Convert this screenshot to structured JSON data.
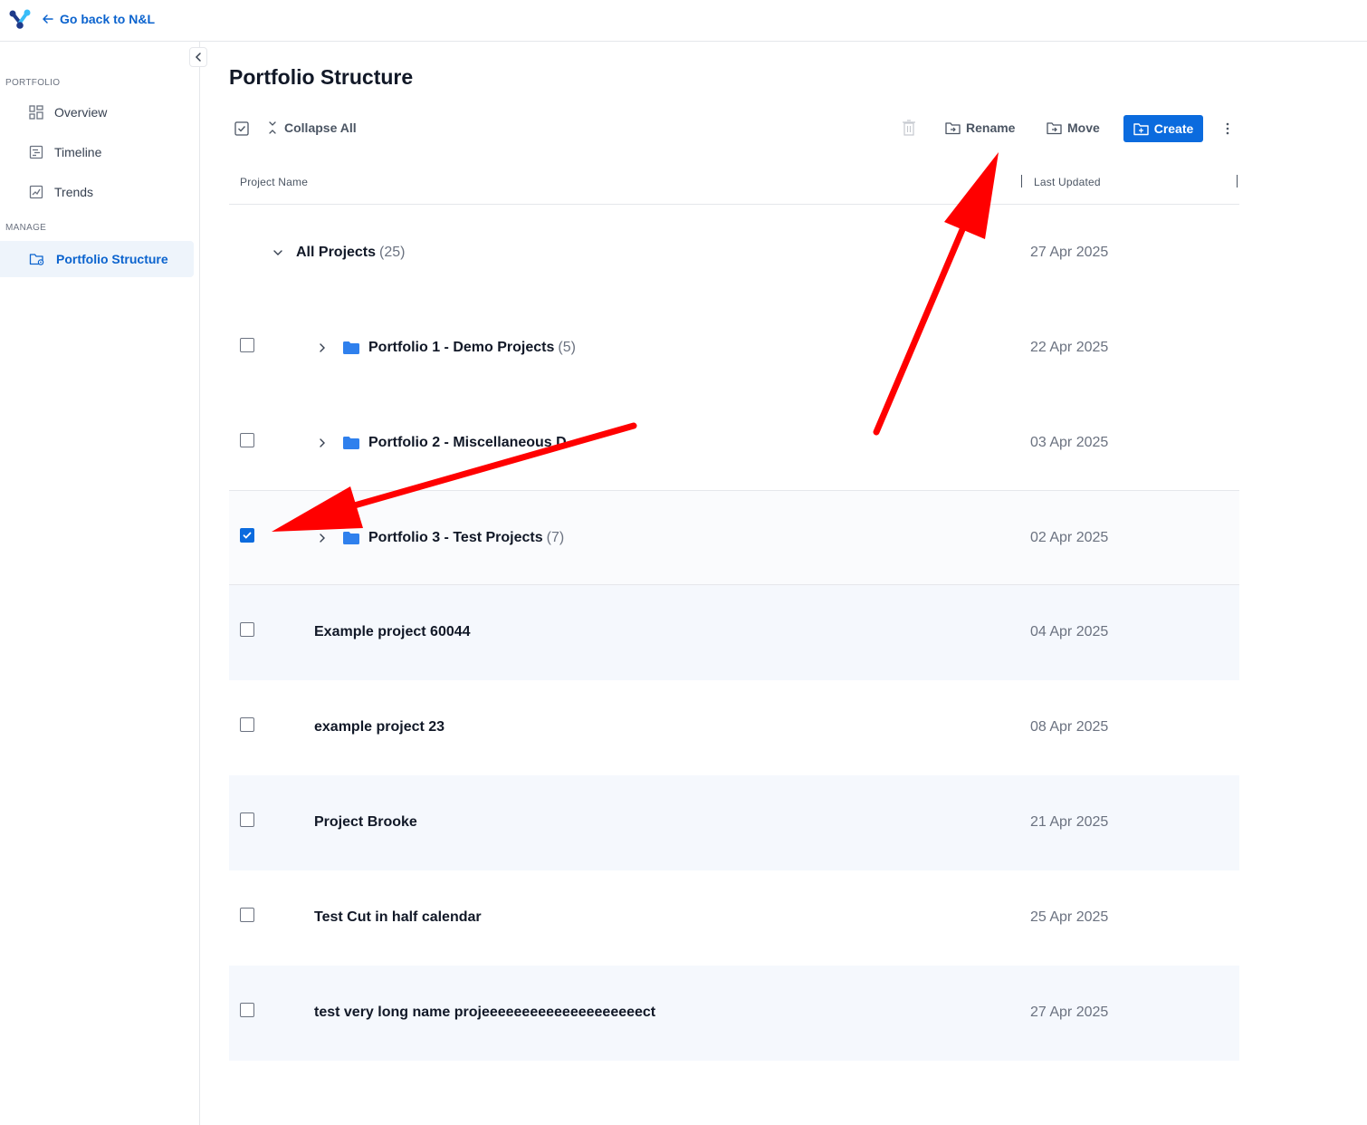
{
  "header": {
    "back_label": "Go back to N&L"
  },
  "sidebar": {
    "section_portfolio": "PORTFOLIO",
    "section_manage": "MANAGE",
    "items": [
      {
        "label": "Overview",
        "icon": "grid-icon"
      },
      {
        "label": "Timeline",
        "icon": "timeline-icon"
      },
      {
        "label": "Trends",
        "icon": "chart-icon"
      },
      {
        "label": "Portfolio Structure",
        "icon": "folder-settings-icon",
        "active": true
      }
    ]
  },
  "main": {
    "title": "Portfolio Structure",
    "toolbar": {
      "collapse_all": "Collapse All",
      "rename": "Rename",
      "move": "Move",
      "create": "Create"
    },
    "columns": {
      "name": "Project Name",
      "updated": "Last Updated"
    },
    "root": {
      "name": "All Projects",
      "count": "(25)",
      "date": "27 Apr 2025"
    },
    "rows": [
      {
        "name": "Portfolio 1 - Demo Projects",
        "count": "(5)",
        "date": "22 Apr 2025",
        "type": "folder",
        "checked": false
      },
      {
        "name": "Portfolio 2 - Miscellaneous D",
        "count": "",
        "date": "03 Apr 2025",
        "type": "folder",
        "checked": false
      },
      {
        "name": "Portfolio 3 - Test Projects",
        "count": "(7)",
        "date": "02 Apr 2025",
        "type": "folder",
        "checked": true
      },
      {
        "name": "Example project 60044",
        "date": "04 Apr 2025",
        "type": "project",
        "checked": false
      },
      {
        "name": "example project 23",
        "date": "08 Apr 2025",
        "type": "project",
        "checked": false
      },
      {
        "name": "Project Brooke",
        "date": "21 Apr 2025",
        "type": "project",
        "checked": false
      },
      {
        "name": "Test Cut in half calendar",
        "date": "25 Apr 2025",
        "type": "project",
        "checked": false
      },
      {
        "name": "test very long name projeeeeeeeeeeeeeeeeeeeect",
        "date": "27 Apr 2025",
        "type": "project",
        "checked": false
      }
    ]
  },
  "colors": {
    "accent": "#0b6bde",
    "link": "#0b63ce",
    "annotation": "#ff0000"
  }
}
